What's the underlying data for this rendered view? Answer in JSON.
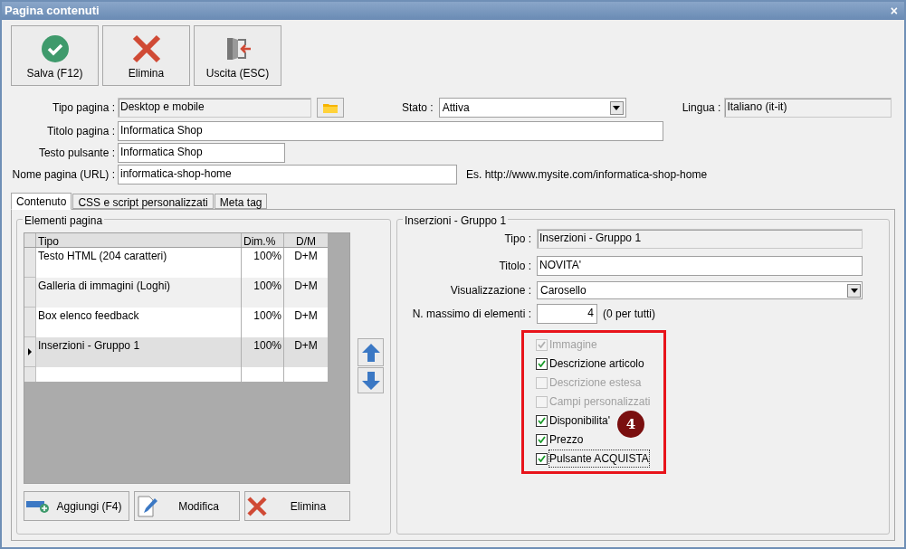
{
  "window": {
    "title": "Pagina contenuti",
    "close": "×"
  },
  "toolbar": [
    {
      "kind": "save",
      "label": "Salva (F12)"
    },
    {
      "kind": "delete",
      "label": "Elimina"
    },
    {
      "kind": "exit",
      "label": "Uscita (ESC)"
    }
  ],
  "form": {
    "tipo_pagina": {
      "label": "Tipo pagina :",
      "value": "Desktop e mobile"
    },
    "stato": {
      "label": "Stato :",
      "value": "Attiva"
    },
    "lingua": {
      "label": "Lingua :",
      "value": "Italiano (it-it)"
    },
    "titolo_pagina": {
      "label": "Titolo pagina :",
      "value": "Informatica Shop"
    },
    "testo_pulsante": {
      "label": "Testo pulsante :",
      "value": "Informatica Shop"
    },
    "nome_pagina": {
      "label": "Nome pagina (URL) :",
      "value": "informatica-shop-home",
      "hint": "Es. http://www.mysite.com/informatica-shop-home"
    }
  },
  "tabs": [
    {
      "label": "Contenuto",
      "selected": true
    },
    {
      "label": "CSS e script personalizzati",
      "selected": false
    },
    {
      "label": "Meta tag",
      "selected": false
    }
  ],
  "elements": {
    "title": "Elementi pagina",
    "columns": [
      "Tipo",
      "Dim.%",
      "D/M"
    ],
    "rows": [
      {
        "tipo": "Testo HTML (204 caratteri)",
        "dim": "100%",
        "dm": "D+M",
        "selected": false
      },
      {
        "tipo": "Galleria di immagini (Loghi)",
        "dim": "100%",
        "dm": "D+M",
        "selected": false
      },
      {
        "tipo": "Box elenco feedback",
        "dim": "100%",
        "dm": "D+M",
        "selected": false
      },
      {
        "tipo": "Inserzioni - Gruppo 1",
        "dim": "100%",
        "dm": "D+M",
        "selected": true
      }
    ],
    "buttons": [
      {
        "kind": "add",
        "label": "Aggiungi (F4)"
      },
      {
        "kind": "edit",
        "label": "Modifica"
      },
      {
        "kind": "delete",
        "label": "Elimina"
      }
    ]
  },
  "detail": {
    "title": "Inserzioni - Gruppo 1",
    "tipo": {
      "label": "Tipo :",
      "value": "Inserzioni - Gruppo 1"
    },
    "titolo": {
      "label": "Titolo :",
      "value": "NOVITA'"
    },
    "visualizzazione": {
      "label": "Visualizzazione :",
      "value": "Carosello"
    },
    "massimo": {
      "label": "N. massimo di elementi :",
      "value": "4",
      "note": "(0 per tutti)"
    },
    "options": [
      {
        "label": "Immagine",
        "checked": true,
        "disabled": true,
        "focused": false
      },
      {
        "label": "Descrizione articolo",
        "checked": true,
        "disabled": false,
        "focused": false
      },
      {
        "label": "Descrizione estesa",
        "checked": false,
        "disabled": true,
        "focused": false
      },
      {
        "label": "Campi personalizzati",
        "checked": false,
        "disabled": true,
        "focused": false
      },
      {
        "label": "Disponibilita'",
        "checked": true,
        "disabled": false,
        "focused": false
      },
      {
        "label": "Prezzo",
        "checked": true,
        "disabled": false,
        "focused": false
      },
      {
        "label": "Pulsante ACQUISTA",
        "checked": true,
        "disabled": false,
        "focused": true
      }
    ],
    "callout": "4"
  }
}
